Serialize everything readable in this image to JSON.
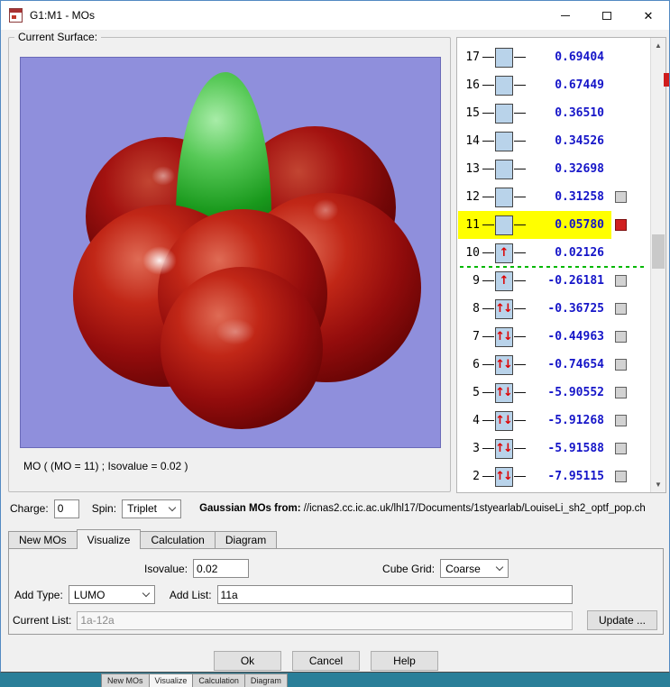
{
  "colors": {
    "accent_border": "#5389c2",
    "viewport_bg": "#8f8fdc",
    "surface_red": "#a31210",
    "surface_green": "#19991c",
    "energy_text": "#1515c8",
    "highlight_row": "#ffff00",
    "checkbox_selected": "#d01f1f",
    "divider_green": "#00b800",
    "background_window_teal": "#2a7f99"
  },
  "icons": {
    "close": "✕",
    "scroll_up": "▲",
    "scroll_down": "▼"
  },
  "window": {
    "title": "G1:M1 - MOs"
  },
  "surface": {
    "group_label": "Current Surface:",
    "caption": "MO ( (MO = 11) ; Isovalue = 0.02 )"
  },
  "mo_list": {
    "rows": [
      {
        "num": "17",
        "arrows": "",
        "energy": "0.69404",
        "checkbox": "none",
        "highlight": false,
        "divider_below": false
      },
      {
        "num": "16",
        "arrows": "",
        "energy": "0.67449",
        "checkbox": "none",
        "highlight": false,
        "divider_below": false
      },
      {
        "num": "15",
        "arrows": "",
        "energy": "0.36510",
        "checkbox": "none",
        "highlight": false,
        "divider_below": false
      },
      {
        "num": "14",
        "arrows": "",
        "energy": "0.34526",
        "checkbox": "none",
        "highlight": false,
        "divider_below": false
      },
      {
        "num": "13",
        "arrows": "",
        "energy": "0.32698",
        "checkbox": "none",
        "highlight": false,
        "divider_below": false
      },
      {
        "num": "12",
        "arrows": "",
        "energy": "0.31258",
        "checkbox": "gray",
        "highlight": false,
        "divider_below": false
      },
      {
        "num": "11",
        "arrows": "",
        "energy": "0.05780",
        "checkbox": "red",
        "highlight": true,
        "divider_below": false
      },
      {
        "num": "10",
        "arrows": "↑",
        "energy": "0.02126",
        "checkbox": "none",
        "highlight": false,
        "divider_below": true
      },
      {
        "num": "9",
        "arrows": "↑",
        "energy": "-0.26181",
        "checkbox": "gray",
        "highlight": false,
        "divider_below": false
      },
      {
        "num": "8",
        "arrows": "↑↓",
        "energy": "-0.36725",
        "checkbox": "gray",
        "highlight": false,
        "divider_below": false
      },
      {
        "num": "7",
        "arrows": "↑↓",
        "energy": "-0.44963",
        "checkbox": "gray",
        "highlight": false,
        "divider_below": false
      },
      {
        "num": "6",
        "arrows": "↑↓",
        "energy": "-0.74654",
        "checkbox": "gray",
        "highlight": false,
        "divider_below": false
      },
      {
        "num": "5",
        "arrows": "↑↓",
        "energy": "-5.90552",
        "checkbox": "gray",
        "highlight": false,
        "divider_below": false
      },
      {
        "num": "4",
        "arrows": "↑↓",
        "energy": "-5.91268",
        "checkbox": "gray",
        "highlight": false,
        "divider_below": false
      },
      {
        "num": "3",
        "arrows": "↑↓",
        "energy": "-5.91588",
        "checkbox": "gray",
        "highlight": false,
        "divider_below": false
      },
      {
        "num": "2",
        "arrows": "↑↓",
        "energy": "-7.95115",
        "checkbox": "gray",
        "highlight": false,
        "divider_below": false
      }
    ]
  },
  "form": {
    "charge_label": "Charge:",
    "charge_value": "0",
    "spin_label": "Spin:",
    "spin_value": "Triplet",
    "source_label": "Gaussian MOs from:",
    "source_path": "//icnas2.cc.ic.ac.uk/lhl17/Documents/1styearlab/LouiseLi_sh2_optf_pop.ch"
  },
  "tabs": {
    "items": [
      "New MOs",
      "Visualize",
      "Calculation",
      "Diagram"
    ],
    "active": "Visualize"
  },
  "visualize_tab": {
    "isovalue_label": "Isovalue:",
    "isovalue_value": "0.02",
    "cube_grid_label": "Cube Grid:",
    "cube_grid_value": "Coarse",
    "add_type_label": "Add Type:",
    "add_type_value": "LUMO",
    "add_list_label": "Add List:",
    "add_list_value": "11a",
    "current_list_label": "Current List:",
    "current_list_value": "1a-12a",
    "update_button": "Update ..."
  },
  "dialog_buttons": {
    "ok": "Ok",
    "cancel": "Cancel",
    "help": "Help"
  },
  "background_window": {
    "tabs": [
      "New MOs",
      "Visualize",
      "Calculation",
      "Diagram"
    ],
    "active": "Visualize"
  }
}
